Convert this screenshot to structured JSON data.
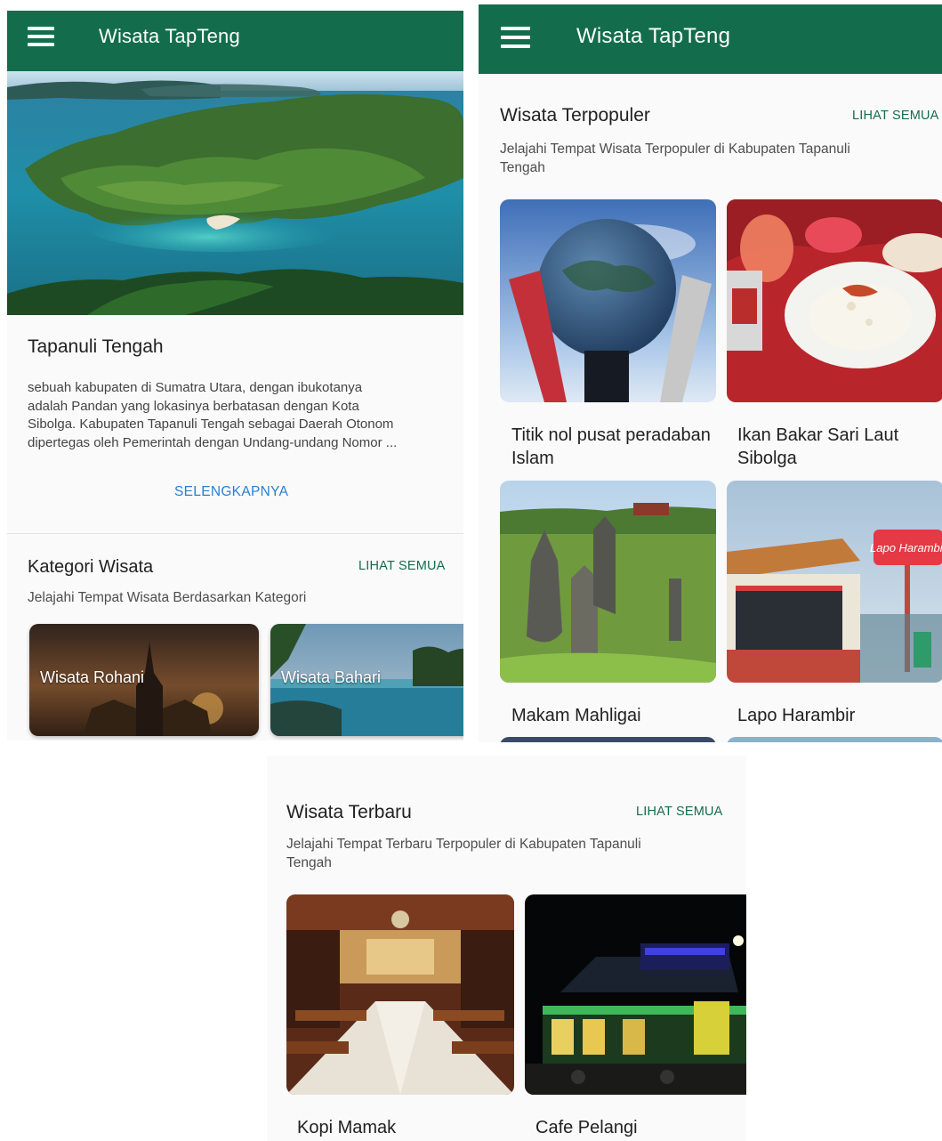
{
  "app": {
    "title": "Wisata TapTeng"
  },
  "intro": {
    "title": "Tapanuli Tengah",
    "description_lines": [
      "sebuah kabupaten di Sumatra Utara, dengan ibukotanya",
      "adalah Pandan yang lokasinya berbatasan dengan Kota",
      "Sibolga. Kabupaten Tapanuli Tengah sebagai Daerah Otonom",
      "dipertegas oleh Pemerintah dengan Undang-undang Nomor ..."
    ],
    "more_label": "SELENGKAPNYA"
  },
  "kategori": {
    "title": "Kategori Wisata",
    "see_all": "LIHAT SEMUA",
    "subtitle": "Jelajahi Tempat Wisata Berdasarkan Kategori",
    "items": [
      {
        "label": "Wisata Rohani"
      },
      {
        "label": "Wisata Bahari"
      }
    ]
  },
  "terpopuler": {
    "title": "Wisata Terpopuler",
    "see_all": "LIHAT SEMUA",
    "subtitle_lines": [
      "Jelajahi Tempat Wisata Terpopuler di Kabupaten Tapanuli",
      "Tengah"
    ],
    "items": [
      {
        "name_lines": [
          "Titik nol pusat peradaban",
          "Islam"
        ]
      },
      {
        "name_lines": [
          "Ikan Bakar Sari Laut",
          "Sibolga"
        ]
      },
      {
        "name_lines": [
          "Makam Mahligai"
        ]
      },
      {
        "name_lines": [
          "Lapo Harambir"
        ]
      }
    ],
    "sign_text": "Lapo Harambir"
  },
  "terbaru": {
    "title": "Wisata Terbaru",
    "see_all": "LIHAT SEMUA",
    "subtitle_lines": [
      "Jelajahi Tempat Terbaru Terpopuler di Kabupaten Tapanuli",
      "Tengah"
    ],
    "items": [
      {
        "name": "Kopi Mamak"
      },
      {
        "name": "Cafe Pelangi"
      }
    ]
  },
  "colors": {
    "appbar": "#136d4d",
    "link": "#136d4d",
    "more_link": "#2b7fd1",
    "background": "#fafafa"
  },
  "icons": {
    "menu": "menu-icon"
  }
}
